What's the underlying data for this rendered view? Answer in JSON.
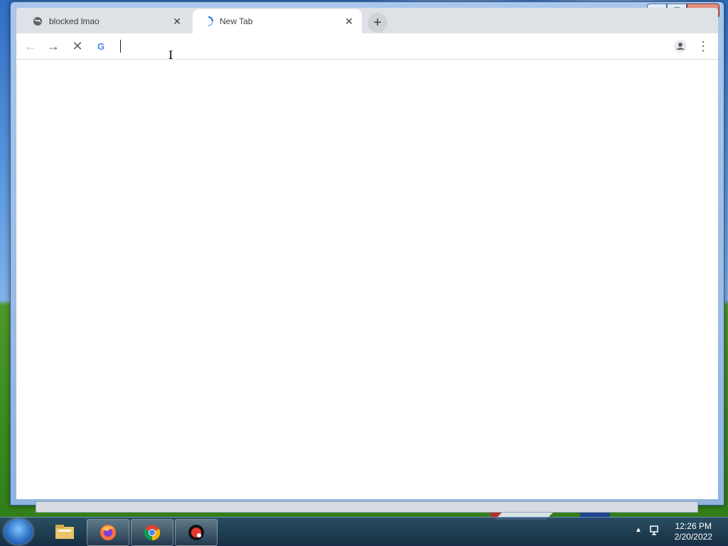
{
  "window": {
    "minimize": "—",
    "maximize": "❐",
    "close": "✕"
  },
  "tabs": [
    {
      "label": "blocked lmao",
      "icon": "globe-icon",
      "close": "✕"
    },
    {
      "label": "New Tab",
      "icon": "loading-spinner-icon",
      "close": "✕"
    }
  ],
  "new_tab_symbol": "+",
  "toolbar": {
    "back": "←",
    "forward": "→",
    "stop": "✕",
    "omnibox_icon": "G",
    "omnibox_value": "",
    "profile_icon": "person-icon",
    "menu": "⋮"
  },
  "taskbar": {
    "apps": [
      "file-explorer-icon",
      "firefox-icon",
      "chrome-icon",
      "app-icon"
    ],
    "time": "12:26 PM",
    "date": "2/20/2022"
  }
}
